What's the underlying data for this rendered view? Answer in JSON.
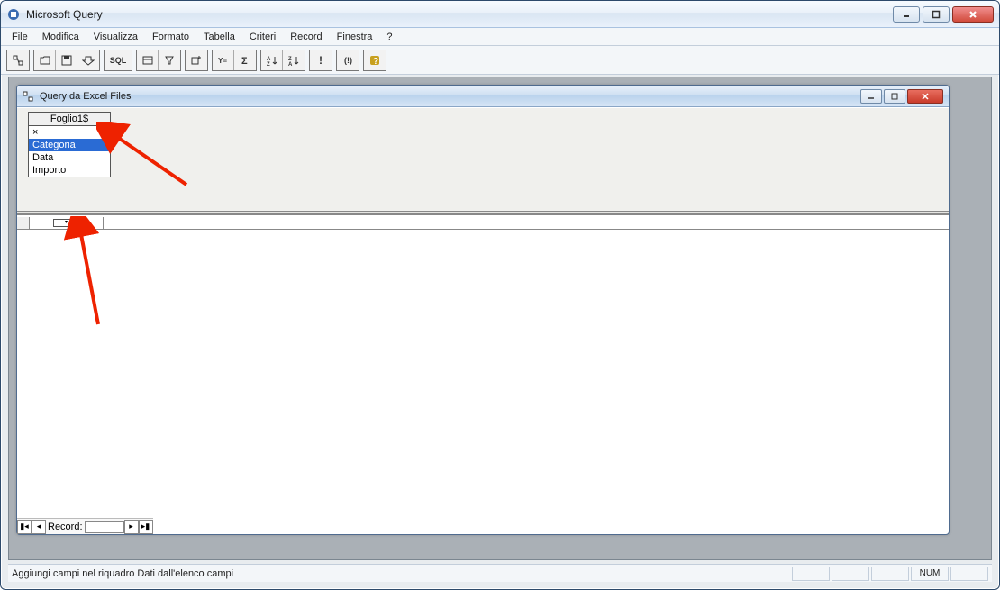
{
  "app": {
    "title": "Microsoft Query"
  },
  "menu": {
    "items": [
      "File",
      "Modifica",
      "Visualizza",
      "Formato",
      "Tabella",
      "Criteri",
      "Record",
      "Finestra",
      "?"
    ]
  },
  "toolbar": {
    "groups": [
      [
        "new-query-icon"
      ],
      [
        "open-icon",
        "save-icon",
        "return-data-icon"
      ],
      [
        "sql"
      ],
      [
        "show-tables-icon",
        "show-criteria-icon"
      ],
      [
        "add-table-icon"
      ],
      [
        "criteria-equals-icon",
        "totals-icon"
      ],
      [
        "sort-asc-icon",
        "sort-desc-icon"
      ],
      [
        "run-icon"
      ],
      [
        "auto-query-icon"
      ],
      [
        "help-icon"
      ]
    ],
    "sql_label": "SQL"
  },
  "child": {
    "title": "Query da Excel Files"
  },
  "table_box": {
    "name": "Foglio1$",
    "fields": [
      "×",
      "Categoria",
      "Data",
      "Importo"
    ],
    "selected_index": 1
  },
  "record_nav": {
    "label": "Record:"
  },
  "statusbar": {
    "text": "Aggiungi campi nel riquadro Dati dall'elenco campi",
    "indicators": [
      "",
      "",
      "",
      "NUM",
      ""
    ]
  }
}
